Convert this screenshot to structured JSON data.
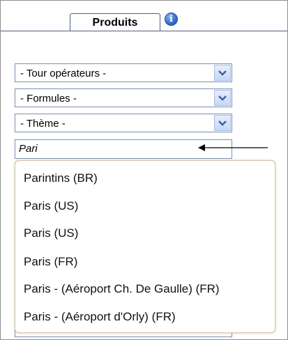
{
  "tabs": {
    "produits_label": "Produits"
  },
  "info_icon": {
    "glyph": "i",
    "icon": "info-icon"
  },
  "filters": {
    "tour_operateurs": "- Tour opérateurs -",
    "formules": "- Formules -",
    "theme": "- Thème -"
  },
  "search": {
    "value": "Pari"
  },
  "suggestions": [
    "Parintins (BR)",
    "Paris (US)",
    "Paris (US)",
    "Paris (FR)",
    "Paris - (Aéroport Ch. De Gaulle) (FR)",
    "Paris - (Aéroport d'Orly) (FR)"
  ],
  "colors": {
    "border": "#7a8faf",
    "dropdown_border": "#d6c7a2",
    "info_blue": "#3a6fd0"
  }
}
